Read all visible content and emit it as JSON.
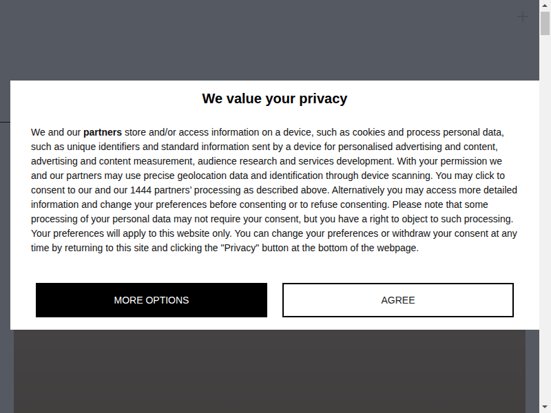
{
  "dialog": {
    "title": "We value your privacy",
    "body": [
      {
        "text": "We and our ",
        "kind": "plain"
      },
      {
        "text": "partners",
        "kind": "link"
      },
      {
        "text": " store and/or access information on a device, such as cookies and process personal data, such as unique identifiers and standard information sent by a device for personalised advertising and content, advertising and content measurement, audience research and services development. With your permission we and our partners may use precise geolocation data and identification through device scanning. You may click to consent to our and our 1444 partners’ processing as described above. Alternatively you may access more detailed information and change your preferences before consenting or to refuse consenting. Please note that some processing of your personal data may not require your consent, but you have a right to object to such processing. Your preferences will apply to this website only. You can change your preferences or withdraw your consent at any time by returning to this site and clicking the \"Privacy\" button at the bottom of the webpage.",
        "kind": "plain"
      }
    ],
    "buttons": [
      {
        "label": "MORE OPTIONS",
        "kind": "primary"
      },
      {
        "label": "AGREE",
        "kind": "secondary"
      }
    ]
  },
  "scrollbar": {
    "level": 0.06
  }
}
